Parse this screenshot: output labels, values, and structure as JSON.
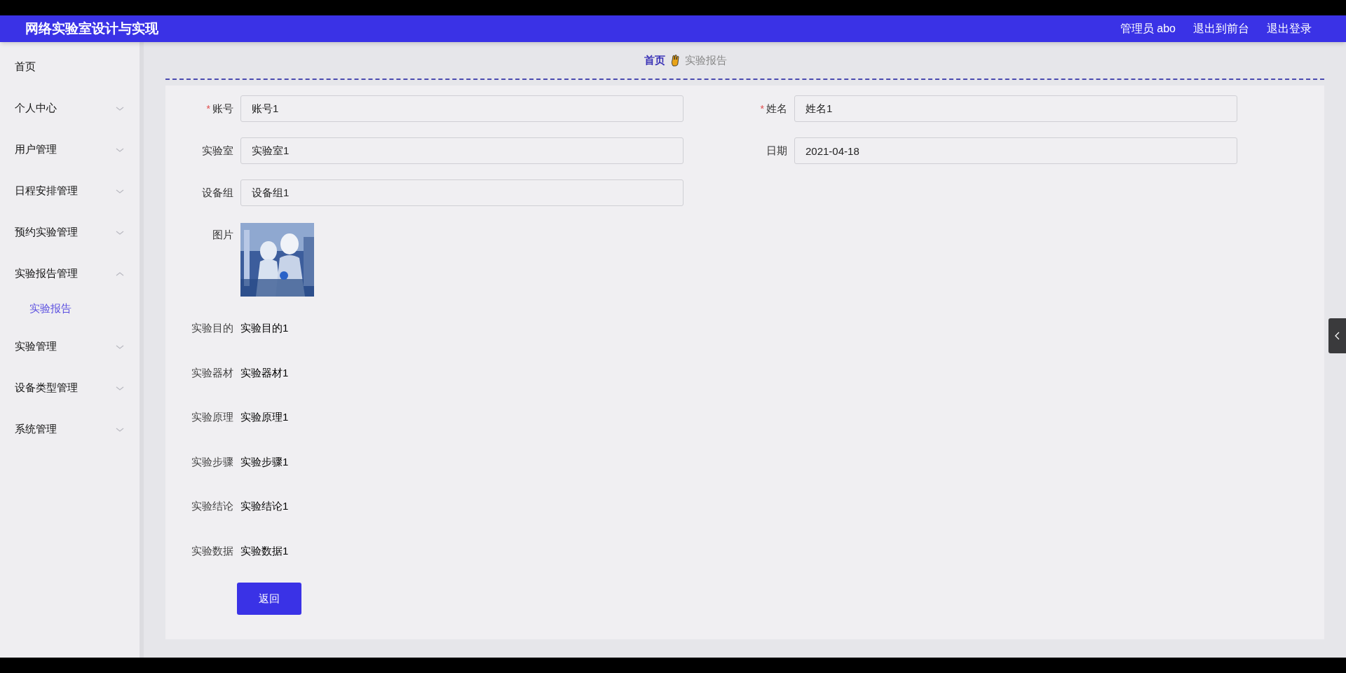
{
  "header": {
    "title": "网络实验室设计与实现",
    "links": [
      "管理员 abo",
      "退出到前台",
      "退出登录"
    ]
  },
  "sidebar": {
    "items": [
      {
        "label": "首页"
      },
      {
        "label": "个人中心",
        "expanded": false
      },
      {
        "label": "用户管理",
        "expanded": false
      },
      {
        "label": "日程安排管理",
        "expanded": false
      },
      {
        "label": "预约实验管理",
        "expanded": false
      },
      {
        "label": "实验报告管理",
        "expanded": true,
        "children": [
          {
            "label": "实验报告",
            "selected": true
          }
        ]
      },
      {
        "label": "实验管理",
        "expanded": false
      },
      {
        "label": "设备类型管理",
        "expanded": false
      },
      {
        "label": "系统管理",
        "expanded": false
      }
    ]
  },
  "breadcrumb": [
    {
      "label": "首页",
      "selected": true
    },
    {
      "label": "实验报告",
      "selected": false
    }
  ],
  "form": {
    "fields": [
      {
        "label": "账号",
        "value": "账号1",
        "required_mark": "*"
      },
      {
        "label": "姓名",
        "value": "姓名1",
        "required_mark": "*"
      },
      {
        "label": "实验室",
        "value": "实验室1"
      },
      {
        "label": "日期",
        "value": "2021-04-18"
      },
      {
        "label": "设备组",
        "value": "设备组1"
      }
    ],
    "image": {
      "label": "图片",
      "kind": "picture"
    },
    "details": [
      {
        "label": "实验目的",
        "value": "实验目的1"
      },
      {
        "label": "实验器材",
        "value": "实验器材1"
      },
      {
        "label": "实验原理",
        "value": "实验原理1"
      },
      {
        "label": "实验步骤",
        "value": "实验步骤1"
      },
      {
        "label": "实验结论",
        "value": "实验结论1"
      },
      {
        "label": "实验数据",
        "value": "实验数据1"
      }
    ],
    "button": "返回"
  }
}
